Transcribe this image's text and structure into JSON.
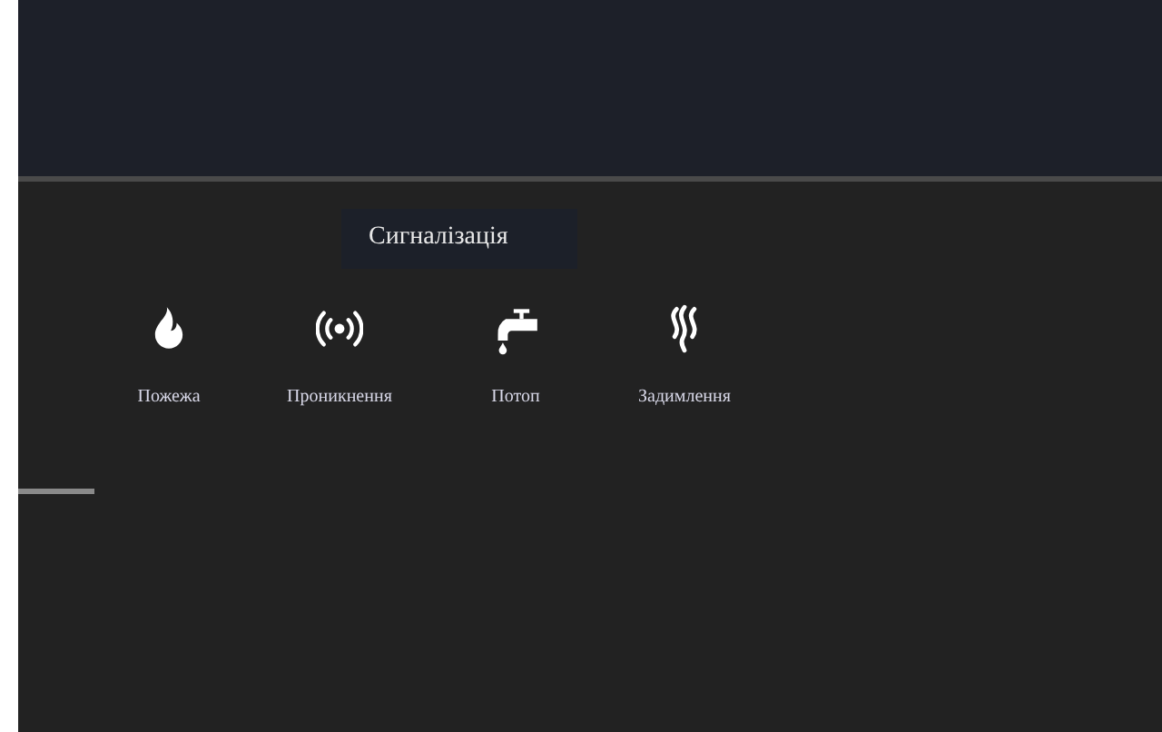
{
  "section": {
    "title": "Сигналізація"
  },
  "alarms": [
    {
      "kind": "fire",
      "label": "Пожежа"
    },
    {
      "kind": "intrusion",
      "label": "Проникнення"
    },
    {
      "kind": "flood",
      "label": "Потоп"
    },
    {
      "kind": "smoke",
      "label": "Задимлення"
    }
  ]
}
